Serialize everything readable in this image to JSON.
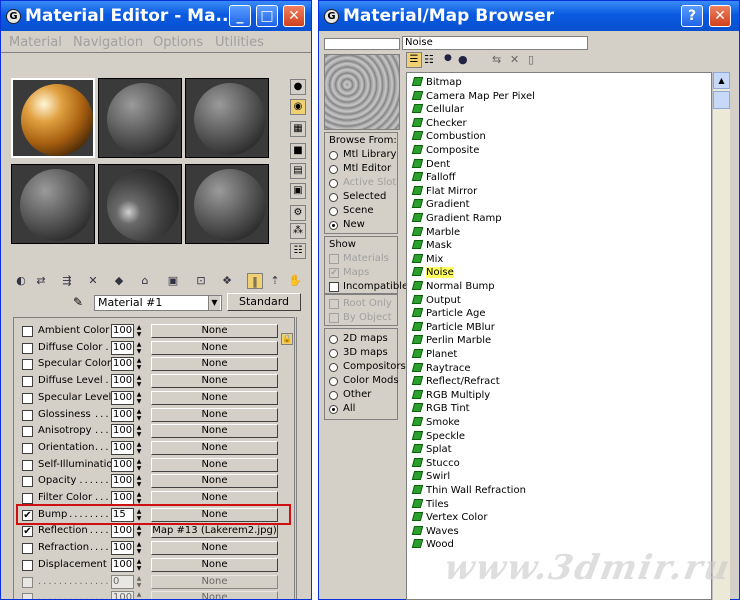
{
  "material_editor": {
    "title": "Material Editor - Ma...",
    "menu": [
      "Material",
      "Navigation",
      "Options",
      "Utilities"
    ],
    "material_name": "Material #1",
    "type_button": "Standard",
    "map_rows": [
      {
        "label": "Ambient Color",
        "checked": false,
        "amount": "100",
        "map": "None"
      },
      {
        "label": "Diffuse Color",
        "checked": false,
        "amount": "100",
        "map": "None"
      },
      {
        "label": "Specular Color",
        "checked": false,
        "amount": "100",
        "map": "None"
      },
      {
        "label": "Diffuse Level",
        "checked": false,
        "amount": "100",
        "map": "None"
      },
      {
        "label": "Specular Level",
        "checked": false,
        "amount": "100",
        "map": "None"
      },
      {
        "label": "Glossiness",
        "checked": false,
        "amount": "100",
        "map": "None"
      },
      {
        "label": "Anisotropy",
        "checked": false,
        "amount": "100",
        "map": "None"
      },
      {
        "label": "Orientation",
        "checked": false,
        "amount": "100",
        "map": "None"
      },
      {
        "label": "Self-Illumination",
        "checked": false,
        "amount": "100",
        "map": "None"
      },
      {
        "label": "Opacity",
        "checked": false,
        "amount": "100",
        "map": "None"
      },
      {
        "label": "Filter Color",
        "checked": false,
        "amount": "100",
        "map": "None"
      },
      {
        "label": "Bump",
        "checked": true,
        "amount": "15",
        "map": "None"
      },
      {
        "label": "Reflection",
        "checked": true,
        "amount": "100",
        "map": "Map #13 (Lakerem2.jpg)"
      },
      {
        "label": "Refraction",
        "checked": false,
        "amount": "100",
        "map": "None"
      },
      {
        "label": "Displacement",
        "checked": false,
        "amount": "100",
        "map": "None"
      },
      {
        "label": "",
        "checked": false,
        "amount": "0",
        "map": "None"
      },
      {
        "label": "",
        "checked": false,
        "amount": "100",
        "map": "None"
      }
    ]
  },
  "map_browser": {
    "title": "Material/Map Browser",
    "selected_name": "Noise",
    "browse_from": {
      "label": "Browse From:",
      "options": [
        {
          "text": "Mtl Library",
          "selected": false,
          "enabled": true
        },
        {
          "text": "Mtl Editor",
          "selected": false,
          "enabled": true
        },
        {
          "text": "Active Slot",
          "selected": false,
          "enabled": false
        },
        {
          "text": "Selected",
          "selected": false,
          "enabled": true
        },
        {
          "text": "Scene",
          "selected": false,
          "enabled": true
        },
        {
          "text": "New",
          "selected": true,
          "enabled": true
        }
      ]
    },
    "show": {
      "label": "Show",
      "options": [
        {
          "text": "Materials",
          "checked": false,
          "enabled": false
        },
        {
          "text": "Maps",
          "checked": true,
          "enabled": false
        },
        {
          "text": "Incompatible",
          "checked": false,
          "enabled": true
        }
      ]
    },
    "root_only": "Root Only",
    "by_object": "By Object",
    "categories": [
      {
        "text": "2D maps",
        "selected": false
      },
      {
        "text": "3D maps",
        "selected": false
      },
      {
        "text": "Compositors",
        "selected": false
      },
      {
        "text": "Color Mods",
        "selected": false
      },
      {
        "text": "Other",
        "selected": false
      },
      {
        "text": "All",
        "selected": true
      }
    ],
    "maps": [
      "Bitmap",
      "Camera Map Per Pixel",
      "Cellular",
      "Checker",
      "Combustion",
      "Composite",
      "Dent",
      "Falloff",
      "Flat Mirror",
      "Gradient",
      "Gradient Ramp",
      "Marble",
      "Mask",
      "Mix",
      "Noise",
      "Normal Bump",
      "Output",
      "Particle Age",
      "Particle MBlur",
      "Perlin Marble",
      "Planet",
      "Raytrace",
      "Reflect/Refract",
      "RGB Multiply",
      "RGB Tint",
      "Smoke",
      "Speckle",
      "Splat",
      "Stucco",
      "Swirl",
      "Thin Wall Refraction",
      "Tiles",
      "Vertex Color",
      "Waves",
      "Wood"
    ],
    "highlighted_map": "Noise"
  },
  "watermark": "www.3dmir.ru"
}
